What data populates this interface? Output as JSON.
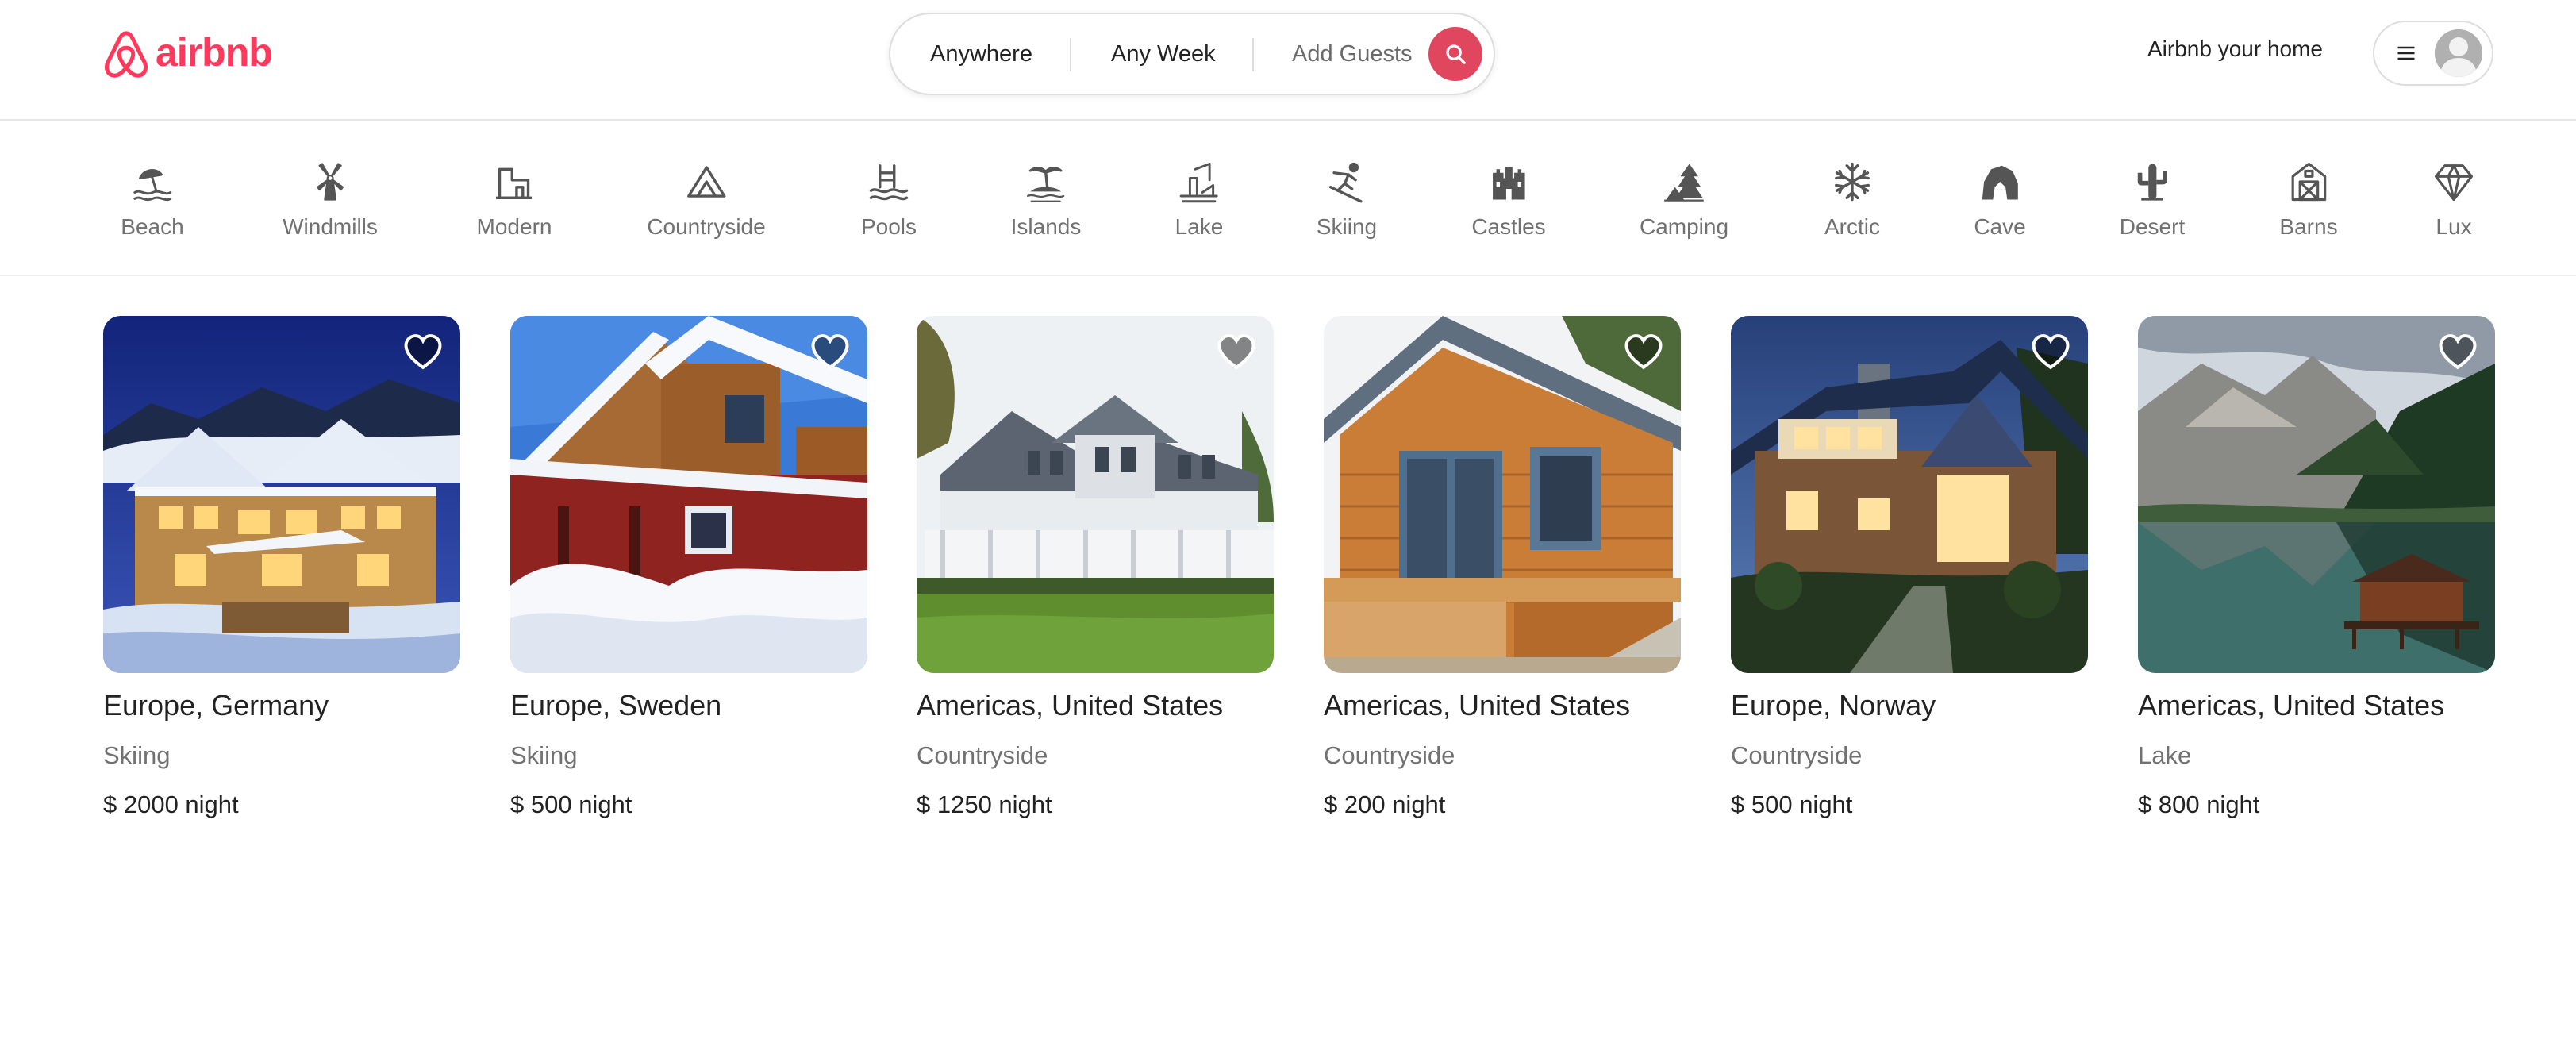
{
  "header": {
    "logo_text": "airbnb",
    "brand_color": "#ff385c",
    "search": {
      "anywhere": "Anywhere",
      "week": "Any Week",
      "guests": "Add Guests",
      "search_icon": "search-icon"
    },
    "host_link": "Airbnb your home",
    "menu_icon": "hamburger-menu-icon",
    "avatar_icon": "user-avatar-icon"
  },
  "categories": [
    {
      "label": "Beach",
      "icon": "beach-icon"
    },
    {
      "label": "Windmills",
      "icon": "windmill-icon"
    },
    {
      "label": "Modern",
      "icon": "modern-building-icon"
    },
    {
      "label": "Countryside",
      "icon": "mountain-icon"
    },
    {
      "label": "Pools",
      "icon": "pool-icon"
    },
    {
      "label": "Islands",
      "icon": "island-icon"
    },
    {
      "label": "Lake",
      "icon": "lake-fishing-icon"
    },
    {
      "label": "Skiing",
      "icon": "skier-icon"
    },
    {
      "label": "Castles",
      "icon": "castle-icon"
    },
    {
      "label": "Camping",
      "icon": "camping-icon"
    },
    {
      "label": "Arctic",
      "icon": "snowflake-icon"
    },
    {
      "label": "Cave",
      "icon": "cave-icon"
    },
    {
      "label": "Desert",
      "icon": "cactus-icon"
    },
    {
      "label": "Barns",
      "icon": "barn-icon"
    },
    {
      "label": "Lux",
      "icon": "diamond-icon"
    }
  ],
  "listings": [
    {
      "location": "Europe, Germany",
      "category": "Skiing",
      "price": "$ 2000 night",
      "photo": "snowy-chalet-photo"
    },
    {
      "location": "Europe, Sweden",
      "category": "Skiing",
      "price": "$ 500 night",
      "photo": "red-cabin-snow-photo"
    },
    {
      "location": "Americas, United States",
      "category": "Countryside",
      "price": "$ 1250 night",
      "photo": "white-farmhouse-photo"
    },
    {
      "location": "Americas, United States",
      "category": "Countryside",
      "price": "$ 200 night",
      "photo": "log-cabin-photo"
    },
    {
      "location": "Europe, Norway",
      "category": "Countryside",
      "price": "$ 500 night",
      "photo": "modern-house-night-photo"
    },
    {
      "location": "Americas, United States",
      "category": "Lake",
      "price": "$ 800 night",
      "photo": "lake-boathouse-photo"
    }
  ]
}
